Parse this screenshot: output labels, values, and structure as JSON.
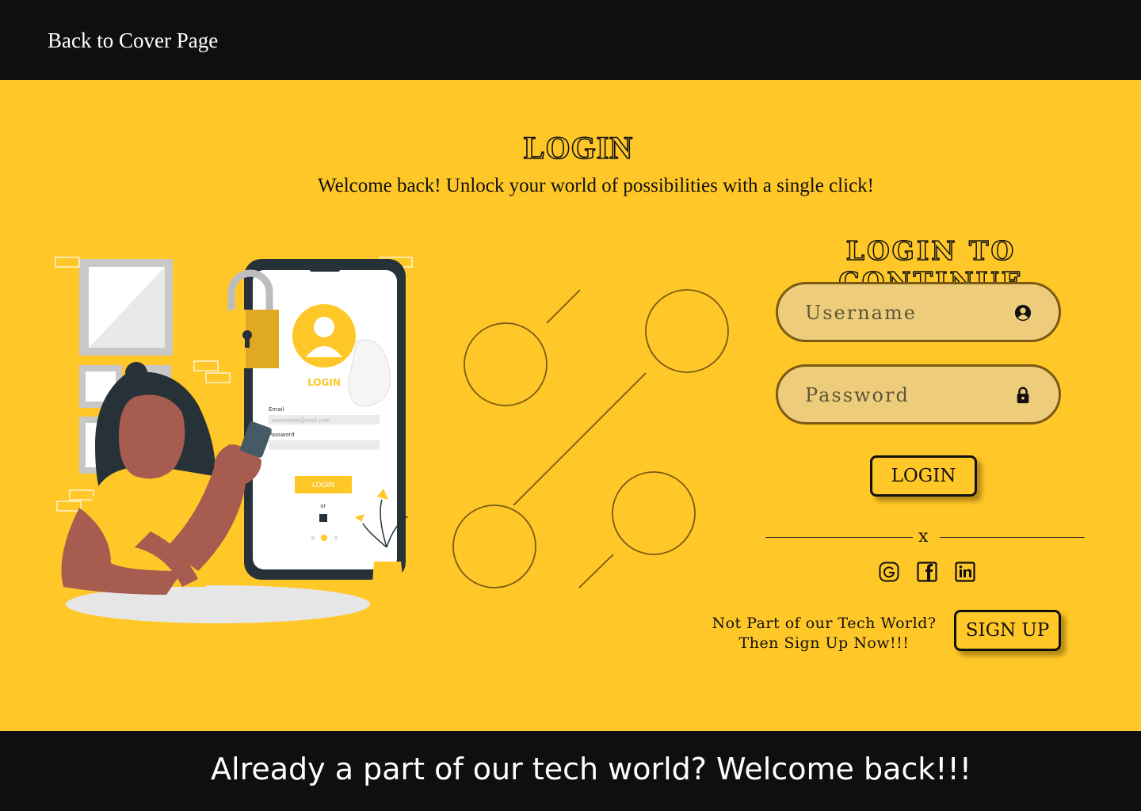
{
  "nav": {
    "back_label": "Back to Cover Page"
  },
  "header": {
    "title": "LOGIN",
    "subtitle": "Welcome back! Unlock your world of possibilities with a single click!"
  },
  "illustration": {
    "phone_login_label": "LOGIN",
    "email_label": "Email",
    "email_placeholder": "username@mail.com",
    "password_label": "Password",
    "phone_button": "LOGIN",
    "or_label": "or"
  },
  "form": {
    "heading": "LOGIN TO CONTINUE",
    "username_placeholder": "Username",
    "password_placeholder": "Password",
    "username_icon": "user-circle-icon",
    "password_icon": "lock-icon",
    "login_label": "LOGIN",
    "divider_label": "x",
    "social": [
      "google-icon",
      "facebook-icon",
      "linkedin-icon"
    ]
  },
  "signup": {
    "line1": "Not Part of our Tech World?",
    "line2": "Then Sign Up Now!!!",
    "button_label": "SIGN UP"
  },
  "footer": {
    "text": "Already a part of our tech world? Welcome back!!!"
  },
  "colors": {
    "accent": "#ffc727",
    "dark": "#0e0f11",
    "field": "#edcd7b",
    "field_border": "#7c5a14"
  }
}
